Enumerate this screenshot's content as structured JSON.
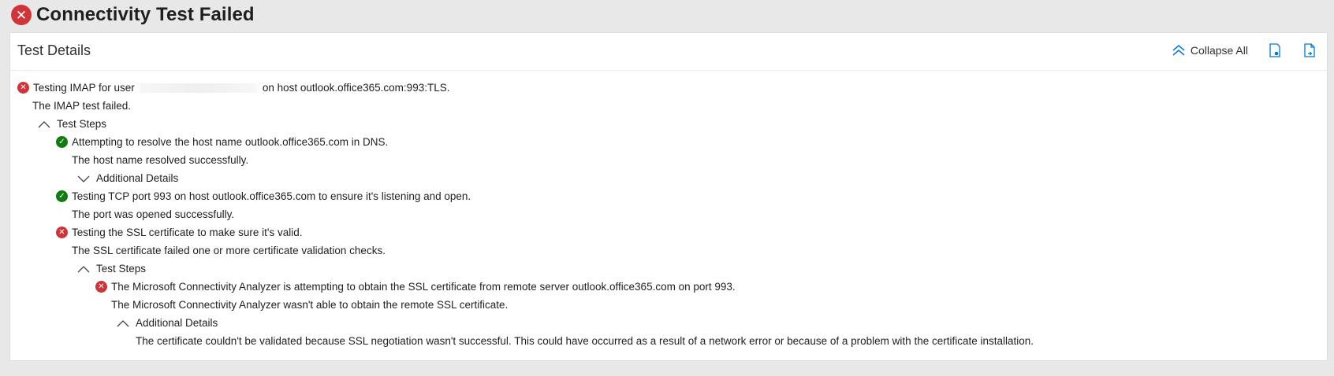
{
  "header": {
    "title": "Connectivity Test Failed",
    "status_icon": "error-circle-icon",
    "status_color": "#d13438"
  },
  "card": {
    "title": "Test Details",
    "toolbar": {
      "collapse_all_label": "Collapse All",
      "icons": [
        "collapse-all-icon",
        "save-report-icon",
        "export-report-icon"
      ],
      "accent_color": "#0078d4"
    }
  },
  "tree": {
    "root": {
      "text_prefix": "Testing IMAP for user",
      "text_suffix": "on host outlook.office365.com:993:TLS.",
      "status": "fail",
      "result": "The IMAP test failed."
    },
    "test_steps_label": "Test Steps",
    "steps": [
      {
        "status": "pass",
        "text": "Attempting to resolve the host name outlook.office365.com in DNS.",
        "result": "The host name resolved successfully.",
        "details_label": "Additional Details"
      },
      {
        "status": "pass",
        "text": "Testing TCP port 993 on host outlook.office365.com to ensure it's listening and open.",
        "result": "The port was opened successfully."
      },
      {
        "status": "fail",
        "text": "Testing the SSL certificate to make sure it's valid.",
        "result": "The SSL certificate failed one or more certificate validation checks.",
        "sub_steps_label": "Test Steps",
        "sub_step": {
          "status": "fail",
          "text": "The Microsoft Connectivity Analyzer is attempting to obtain the SSL certificate from remote server outlook.office365.com on port 993.",
          "result": "The Microsoft Connectivity Analyzer wasn't able to obtain the remote SSL certificate.",
          "details_label": "Additional Details",
          "details_text": "The certificate couldn't be validated because SSL negotiation wasn't successful. This could have occurred as a result of a network error or because of a problem with the certificate installation."
        }
      }
    ],
    "pass_color": "#107c10",
    "fail_color": "#d13438"
  }
}
